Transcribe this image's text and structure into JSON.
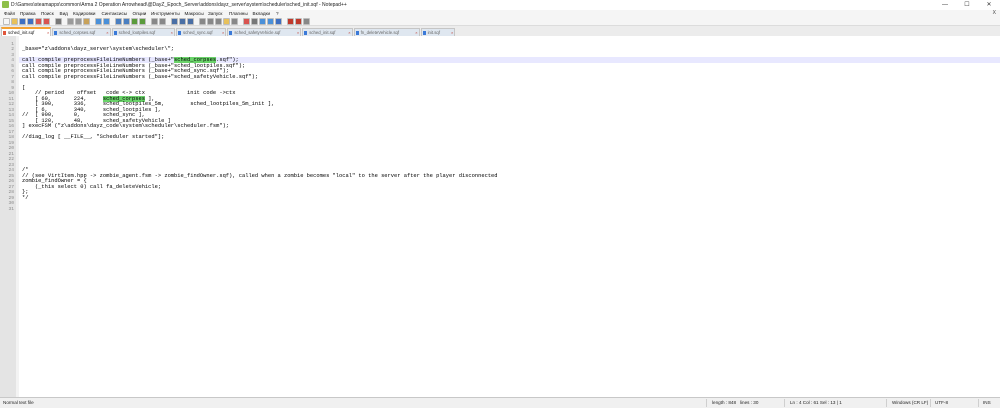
{
  "window": {
    "title": "D:\\Games\\steamapps\\common\\Arma 2 Operation Arrowhead\\@DayZ_Epoch_Server\\addons\\dayz_server\\system\\scheduler\\sched_init.sqf - Notepad++",
    "minimize": "—",
    "maximize": "☐",
    "close": "✕"
  },
  "menu": {
    "items": [
      "Файл",
      "Правка",
      "Поиск",
      "Вид",
      "Кодировки",
      "Синтаксисы",
      "Опции",
      "Инструменты",
      "Макросы",
      "Запуск",
      "Плагины",
      "Вкладки",
      "?"
    ],
    "close_doc": "X"
  },
  "toolbar": {
    "icons": [
      {
        "name": "new-file-icon",
        "color": "#f6f6f6"
      },
      {
        "name": "open-file-icon",
        "color": "#e8c15a"
      },
      {
        "name": "save-icon",
        "color": "#3d6fc2"
      },
      {
        "name": "save-all-icon",
        "color": "#3d6fc2"
      },
      {
        "name": "close-icon",
        "color": "#d9534f"
      },
      {
        "name": "close-all-icon",
        "color": "#d9534f"
      },
      {
        "name": "print-icon",
        "color": "#777777"
      },
      {
        "name": "cut-icon",
        "color": "#9a9a9a"
      },
      {
        "name": "copy-icon",
        "color": "#9a9a9a"
      },
      {
        "name": "paste-icon",
        "color": "#c8a25a"
      },
      {
        "name": "undo-icon",
        "color": "#4a90d9"
      },
      {
        "name": "redo-icon",
        "color": "#4a90d9"
      },
      {
        "name": "find-icon",
        "color": "#4a7fc1"
      },
      {
        "name": "replace-icon",
        "color": "#4a7fc1"
      },
      {
        "name": "zoom-in-icon",
        "color": "#5b9b3c"
      },
      {
        "name": "zoom-out-icon",
        "color": "#5b9b3c"
      },
      {
        "name": "sync-v-icon",
        "color": "#888888"
      },
      {
        "name": "sync-h-icon",
        "color": "#888888"
      },
      {
        "name": "wrap-icon",
        "color": "#4a6fa5"
      },
      {
        "name": "all-chars-icon",
        "color": "#4a6fa5"
      },
      {
        "name": "indent-guide-icon",
        "color": "#4a6fa5"
      },
      {
        "name": "lang-icon",
        "color": "#888888"
      },
      {
        "name": "doc-map-icon",
        "color": "#888888"
      },
      {
        "name": "func-list-icon",
        "color": "#888888"
      },
      {
        "name": "folder-workspace-icon",
        "color": "#e8c15a"
      },
      {
        "name": "monitor-icon",
        "color": "#888888"
      },
      {
        "name": "record-macro-icon",
        "color": "#d9534f"
      },
      {
        "name": "stop-macro-icon",
        "color": "#777777"
      },
      {
        "name": "play-macro-icon",
        "color": "#4a90d9"
      },
      {
        "name": "play-multi-icon",
        "color": "#4a90d9"
      },
      {
        "name": "save-macro-icon",
        "color": "#3d6fc2"
      },
      {
        "name": "spell-check-icon",
        "color": "#c0392b"
      },
      {
        "name": "spell-next-icon",
        "color": "#c0392b"
      },
      {
        "name": "compare-icon",
        "color": "#888888"
      }
    ]
  },
  "tabs": [
    {
      "label": "sched_init.sqf",
      "active": true
    },
    {
      "label": "sched_corpses.sqf",
      "active": false
    },
    {
      "label": "sched_lootpiles.sqf",
      "active": false
    },
    {
      "label": "sched_sync.sqf",
      "active": false
    },
    {
      "label": "sched_safetyVehicle.sqf",
      "active": false
    },
    {
      "label": "sched_init.sqf",
      "active": false
    },
    {
      "label": "fn_deleteVehicle.sqf",
      "active": false
    },
    {
      "label": "init.sqf",
      "active": false
    }
  ],
  "editor": {
    "lines": [
      "",
      "_base=\"z\\addons\\dayz_server\\system\\scheduler\\\";",
      "",
      "call compile preprocessFileLineNumbers (_base+\"sched_corpses.sqf\");",
      "call compile preprocessFileLineNumbers (_base+\"sched_lootpiles.sqf\");",
      "call compile preprocessFileLineNumbers (_base+\"sched_sync.sqf\");",
      "call compile preprocessFileLineNumbers (_base+\"sched_safetyVehicle.sqf\");",
      "",
      "[",
      "    // period    offset   code <-> ctx             init code ->ctx",
      "    [ 60,       224,     sched_corpses ],",
      "    [ 300,      336,     sched_lootpiles_5m,        sched_lootpiles_5m_init ],",
      "    [ 6,        340,     sched_lootpiles ],",
      "//  [ 900,      0,       sched_sync ],",
      "    [ 120,      48,      sched_safetyVehicle ]",
      "] execFSM (\"z\\addons\\dayz_code\\system\\scheduler\\scheduler.fsm\");",
      "",
      "//diag_log [ __FILE__, \"Scheduler started\"];",
      "",
      "",
      "",
      "",
      "",
      "/*",
      "// (see VirtItem.hpp -> zombie_agent.fsm -> zombie_findOwner.sqf), called when a zombie becomes \"local\" to the server after the player disconnected",
      "zombie_findOwner = {",
      "    (_this select 0) call fa_deleteVehicle;",
      "};",
      "*/",
      "",
      ""
    ],
    "highlight": {
      "line": 4,
      "text": "sched_corpses"
    },
    "highlight2": {
      "line": 11,
      "text": "sched_corpses"
    }
  },
  "status": {
    "file_type": "Normal text file",
    "length": "length : 848",
    "lines": "lines : 30",
    "position": "Ln : 4    Col : 61    Sel : 13 | 1",
    "eol": "Windows (CR LF)",
    "encoding": "UTF-8",
    "mode": "INS"
  }
}
